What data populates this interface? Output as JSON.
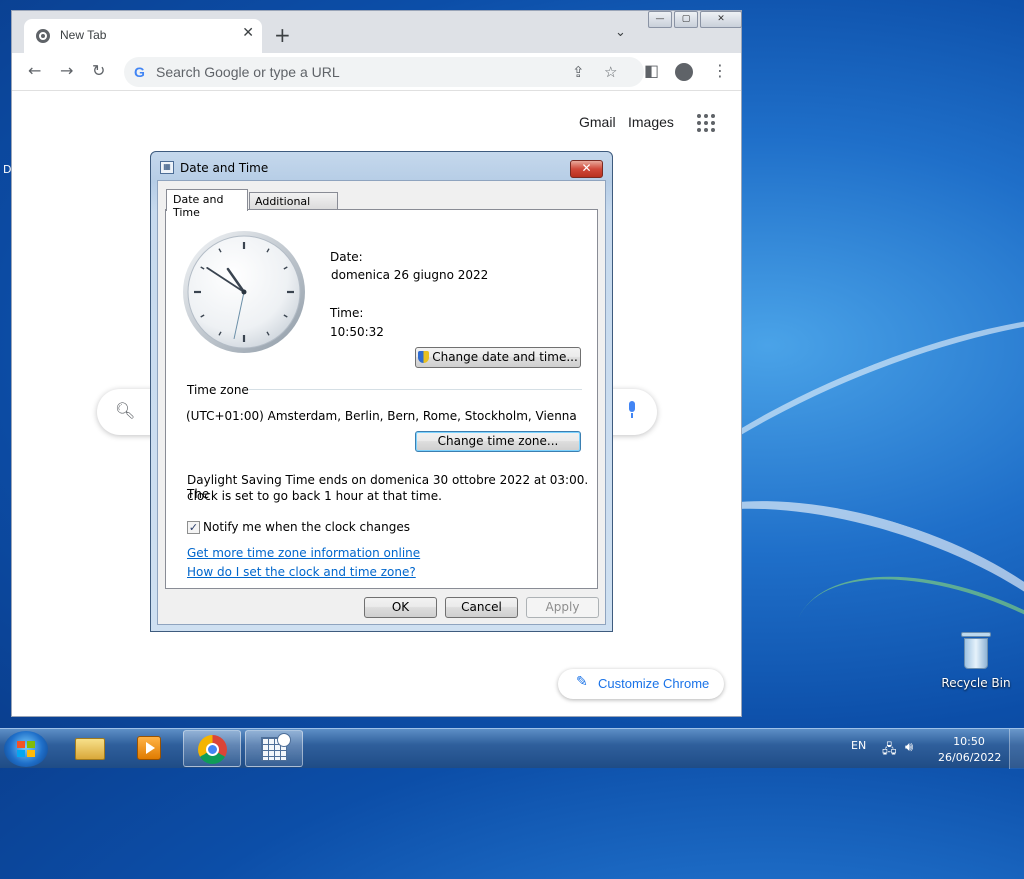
{
  "browser": {
    "tab_title": "New Tab",
    "tab_close": "✕",
    "new_tab": "+",
    "tab_search": "⌄",
    "omnibox_placeholder": "Search Google or type a URL",
    "google_g": "G",
    "links": {
      "gmail": "Gmail",
      "images": "Images"
    },
    "customize_label": "Customize Chrome",
    "window_controls": {
      "minimize": "—",
      "maximize": "▢",
      "close": "✕"
    }
  },
  "dialog": {
    "title": "Date and Time",
    "close": "✕",
    "tabs": [
      "Date and Time",
      "Additional Clocks"
    ],
    "date_label": "Date:",
    "date_value": "domenica 26 giugno 2022",
    "time_label": "Time:",
    "time_value": "10:50:32",
    "change_datetime_button": "Change date and time...",
    "timezone_heading": "Time zone",
    "timezone_value": "(UTC+01:00) Amsterdam, Berlin, Bern, Rome, Stockholm, Vienna",
    "change_timezone_button": "Change time zone...",
    "dst_line1": "Daylight Saving Time ends on domenica 30 ottobre 2022 at 03:00. The",
    "dst_line2": "clock is set to go back 1 hour at that time.",
    "notify_checkbox": "Notify me when the clock changes",
    "notify_checked": true,
    "link_more_info": "Get more time zone information online",
    "link_how_set": "How do I set the clock and time zone?",
    "ok": "OK",
    "cancel": "Cancel",
    "apply": "Apply",
    "clock": {
      "hours": 10,
      "minutes": 50,
      "seconds": 32
    }
  },
  "desktop": {
    "recycle_bin_label": "Recycle Bin",
    "edge_letter": "D"
  },
  "taskbar": {
    "language": "EN",
    "time": "10:50",
    "date": "26/06/2022",
    "pinned": [
      "explorer-icon",
      "media-player-icon",
      "chrome-icon",
      "date-time-control-panel-icon"
    ],
    "active": "chrome-icon"
  },
  "colors": {
    "chrome_tabstrip": "#dee1e6",
    "link_blue": "#1a73e8",
    "dialog_link": "#0066cc",
    "close_red": "#d0493a"
  }
}
